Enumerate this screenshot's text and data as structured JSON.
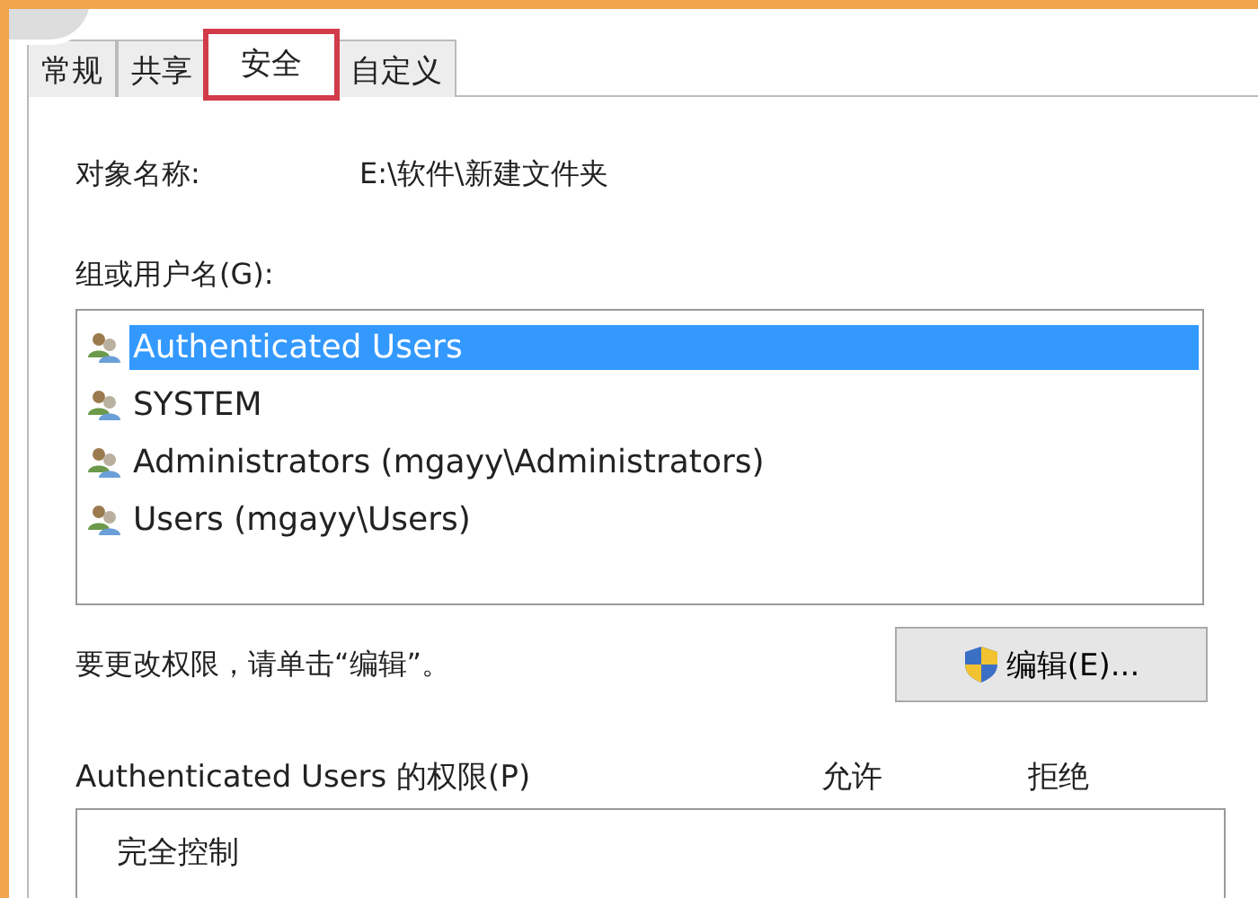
{
  "tabs": [
    {
      "label": "常规",
      "selected": false,
      "highlighted": false
    },
    {
      "label": "共享",
      "selected": false,
      "highlighted": false
    },
    {
      "label": "安全",
      "selected": true,
      "highlighted": true
    },
    {
      "label": "自定义",
      "selected": false,
      "highlighted": false
    }
  ],
  "object_name": {
    "label": "对象名称:",
    "value": "E:\\软件\\新建文件夹"
  },
  "groups": {
    "label": "组或用户名(G):",
    "items": [
      {
        "name": "Authenticated Users",
        "selected": true
      },
      {
        "name": "SYSTEM",
        "selected": false
      },
      {
        "name": "Administrators (mgayy\\Administrators)",
        "selected": false
      },
      {
        "name": "Users (mgayy\\Users)",
        "selected": false
      }
    ]
  },
  "edit_hint": "要更改权限，请单击“编辑”。",
  "edit_button": "编辑(E)...",
  "permissions": {
    "label": "Authenticated Users 的权限(P)",
    "columns": [
      "允许",
      "拒绝"
    ],
    "rows": [
      {
        "name": "完全控制"
      }
    ]
  }
}
